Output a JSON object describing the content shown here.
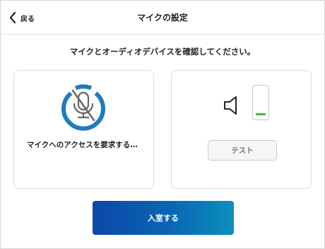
{
  "header": {
    "back_label": "戻る",
    "title": "マイクの設定"
  },
  "instruction": "マイクとオーディオデバイスを確認してください。",
  "mic_card": {
    "icon": "mic-off-icon",
    "status_text": "マイクへのアクセスを要求する…"
  },
  "speaker_card": {
    "icon": "speaker-icon",
    "level_fraction": 0.06,
    "test_label": "テスト"
  },
  "enter_button_label": "入室する",
  "colors": {
    "accent_blue": "#1f7bbf",
    "level_green": "#3cbd3c",
    "button_gradient_start": "#0b48a8",
    "button_gradient_end": "#0b8fbf"
  }
}
